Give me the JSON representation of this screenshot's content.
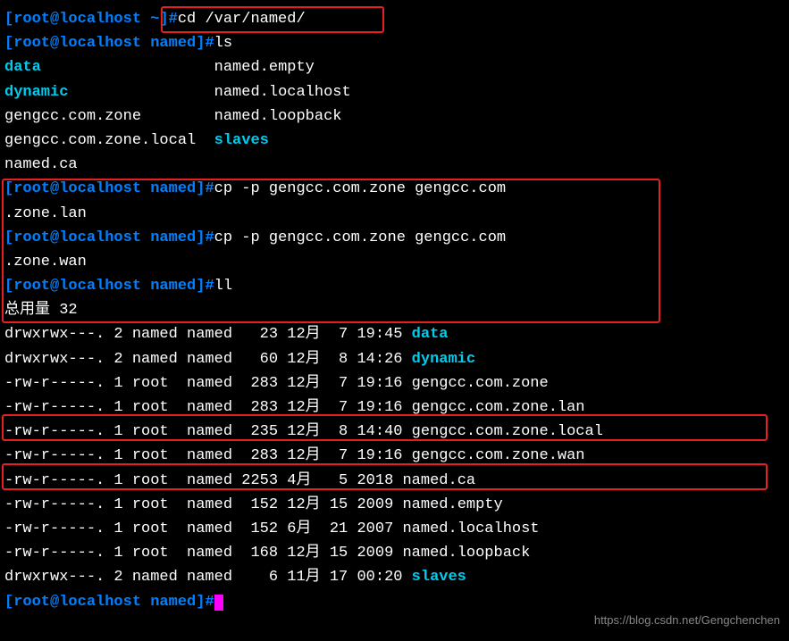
{
  "prompts": {
    "p1_user": "[root@localhost ",
    "p1_path": "~",
    "p1_end": "]#",
    "p2_user": "[root@localhost ",
    "p2_path": "named",
    "p2_end": "]#"
  },
  "commands": {
    "cd": "cd /var/named/",
    "ls": "ls",
    "cp1": "cp -p gengcc.com.zone gengcc.com",
    "cp1b": ".zone.lan",
    "cp2": "cp -p gengcc.com.zone gengcc.com",
    "cp2b": ".zone.wan",
    "ll": "ll"
  },
  "ls_output": {
    "col1": {
      "data": "data",
      "dynamic": "dynamic",
      "zone": "gengcc.com.zone",
      "zonelocal": "gengcc.com.zone.local",
      "namedca": "named.ca"
    },
    "col2": {
      "empty": "named.empty",
      "localhost": "named.localhost",
      "loopback": "named.loopback",
      "slaves": "slaves"
    }
  },
  "total": "总用量 32",
  "ll_rows": [
    {
      "perm": "drwxrwx---. 2 named named   23 12月  7 19:45 ",
      "name": "data",
      "dir": true
    },
    {
      "perm": "drwxrwx---. 2 named named   60 12月  8 14:26 ",
      "name": "dynamic",
      "dir": true
    },
    {
      "perm": "-rw-r-----. 1 root  named  283 12月  7 19:16 ",
      "name": "gengcc.com.zone",
      "dir": false
    },
    {
      "perm": "-rw-r-----. 1 root  named  283 12月  7 19:16 ",
      "name": "gengcc.com.zone.lan",
      "dir": false
    },
    {
      "perm": "-rw-r-----. 1 root  named  235 12月  8 14:40 ",
      "name": "gengcc.com.zone.local",
      "dir": false
    },
    {
      "perm": "-rw-r-----. 1 root  named  283 12月  7 19:16 ",
      "name": "gengcc.com.zone.wan",
      "dir": false
    },
    {
      "perm": "-rw-r-----. 1 root  named 2253 4月   5 2018 ",
      "name": "named.ca",
      "dir": false
    },
    {
      "perm": "-rw-r-----. 1 root  named  152 12月 15 2009 ",
      "name": "named.empty",
      "dir": false
    },
    {
      "perm": "-rw-r-----. 1 root  named  152 6月  21 2007 ",
      "name": "named.localhost",
      "dir": false
    },
    {
      "perm": "-rw-r-----. 1 root  named  168 12月 15 2009 ",
      "name": "named.loopback",
      "dir": false
    },
    {
      "perm": "drwxrwx---. 2 named named    6 11月 17 00:20 ",
      "name": "slaves",
      "dir": true
    }
  ],
  "watermark": "https://blog.csdn.net/Gengchenchen"
}
